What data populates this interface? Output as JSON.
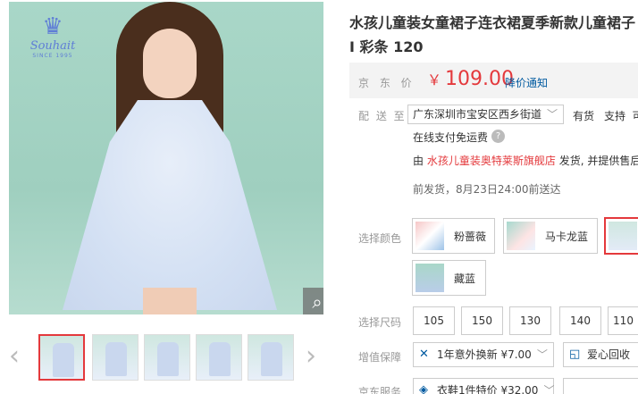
{
  "product": {
    "title": "水孩儿童装女童裙子连衣裙夏季新款儿童裙子I 彩条 120"
  },
  "brand_logo": {
    "brand": "Souhait",
    "since": "SINCE 1995"
  },
  "gallery": {
    "main_alt": "girl in light blue lace dress",
    "thumb_count": 5,
    "active_thumb": 0
  },
  "price": {
    "label": "京 东 价",
    "currency": "￥",
    "value": "109.00",
    "notify": "降价通知"
  },
  "delivery": {
    "label": "配 送 至",
    "address": "广东深圳市宝安区西乡街道",
    "stock": "有货",
    "support": "支持",
    "support_more": "可",
    "free_pay": "在线支付免运费",
    "shop_prefix": "由",
    "shop_name": "水孩儿童装奥特莱斯旗舰店",
    "shop_suffix": "发货, 并提供售后",
    "ship_date": "前发货，8月23日24:00前送达"
  },
  "color": {
    "label": "选择颜色",
    "options": [
      {
        "name": "粉蔷薇"
      },
      {
        "name": "马卡龙蓝"
      },
      {
        "name": ""
      },
      {
        "name": "藏蓝"
      }
    ]
  },
  "size": {
    "label": "选择尺码",
    "options": [
      "105",
      "150",
      "130",
      "140",
      "110"
    ]
  },
  "warranty": {
    "label": "增值保障",
    "options": [
      {
        "text": "1年意外换新 ¥7.00",
        "icon": "wrench-icon"
      },
      {
        "text": "爱心回收",
        "icon": "recycle-icon"
      }
    ]
  },
  "jd_service": {
    "label": "京东服务",
    "option": "衣鞋1件特价 ¥32.00"
  },
  "colors": {
    "accent": "#e4393c",
    "link": "#005aa0",
    "price_bg": "#f3f3f3"
  }
}
